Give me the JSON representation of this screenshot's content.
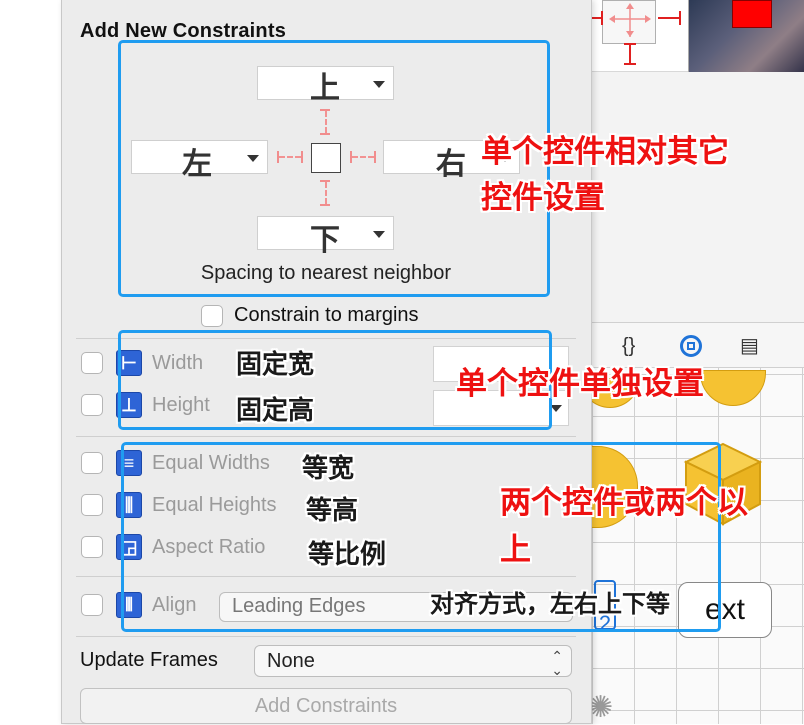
{
  "panel": {
    "title": "Add New Constraints",
    "spacing_label": "Spacing to nearest neighbor",
    "constrain_margins_label": "Constrain to margins",
    "update_frames_label": "Update Frames",
    "update_frames_value": "None",
    "add_button_label": "Add Constraints",
    "align_value": "Leading Edges"
  },
  "pins": {
    "top": "上",
    "left": "左",
    "right": "右",
    "bottom": "下"
  },
  "size_rows": [
    {
      "label": "Width",
      "icon": "width-icon",
      "note": "固定宽"
    },
    {
      "label": "Height",
      "icon": "height-icon",
      "note": "固定高"
    }
  ],
  "multi_rows": [
    {
      "label": "Equal Widths",
      "icon": "equal-widths-icon",
      "note": "等宽"
    },
    {
      "label": "Equal Heights",
      "icon": "equal-heights-icon",
      "note": "等高"
    },
    {
      "label": "Aspect Ratio",
      "icon": "aspect-ratio-icon",
      "note": "等比例"
    }
  ],
  "align_row": {
    "label": "Align",
    "icon": "align-icon"
  },
  "annotations": {
    "single_relative_line1": "单个控件相对其它",
    "single_relative_line2": "控件设置",
    "single_alone": "单个控件单独设置",
    "two_or_more_line1": "两个控件或两个以",
    "two_or_more_line2": "上",
    "align_note": "对齐方式，左右上下等"
  },
  "background": {
    "text_button": "Text",
    "text_button_visible": "ext",
    "number_box": "2"
  },
  "colors": {
    "annotation_box": "#1f9cf0",
    "annotation_text": "#ee1111",
    "constraint_icon": "#2e64d6",
    "strut": "#f18d8d"
  }
}
